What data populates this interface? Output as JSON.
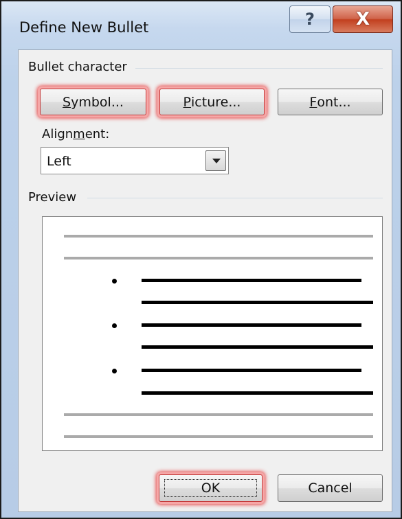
{
  "window": {
    "title": "Define New Bullet",
    "help_glyph": "?",
    "close_glyph": "X"
  },
  "bullet_group": {
    "label": "Bullet character",
    "symbol_button": {
      "mnemonic": "S",
      "rest": "ymbol..."
    },
    "picture_button": {
      "mnemonic": "P",
      "rest": "icture..."
    },
    "font_button": {
      "mnemonic": "F",
      "rest": "ont..."
    }
  },
  "alignment": {
    "label_before": "Align",
    "label_mnemonic": "m",
    "label_after": "ent:",
    "selected": "Left"
  },
  "preview_group": {
    "label": "Preview"
  },
  "footer": {
    "ok_label": "OK",
    "cancel_label": "Cancel"
  },
  "colors": {
    "highlight": "#e63b3b",
    "close_button": "#c2401f"
  }
}
